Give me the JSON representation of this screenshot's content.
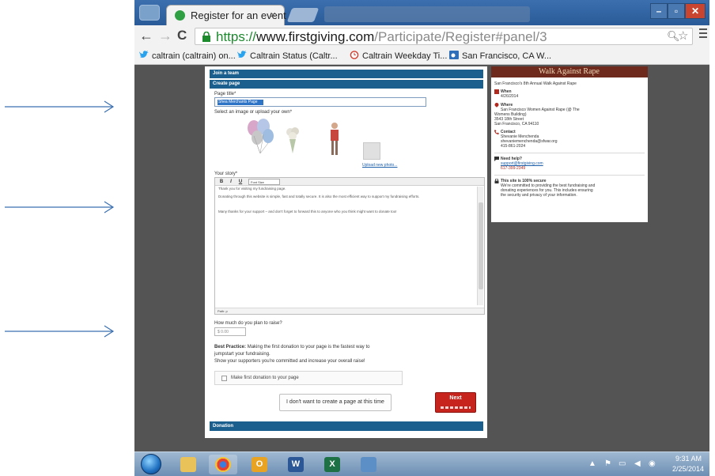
{
  "browser": {
    "tab_title": "Register for an event",
    "tab_close": "×",
    "url_scheme": "https://",
    "url_host": "www.firstgiving.com",
    "url_path": "/Participate/Register#panel/3",
    "bookmarks": [
      {
        "label": "caltrain (caltrain) on...",
        "icon": "twitter-bird-icon"
      },
      {
        "label": "Caltrain Status (Caltr...",
        "icon": "twitter-bird-icon"
      },
      {
        "label": "Caltrain Weekday Ti...",
        "icon": "clock-icon"
      },
      {
        "label": "San Francisco, CA W...",
        "icon": "weather-icon"
      }
    ],
    "accent_color": "#2a5b98"
  },
  "form": {
    "join_team_bar": "Join a team",
    "create_page_bar": "Create page",
    "page_title_label": "Page title*",
    "page_title_value": "Shea Merchants Page",
    "select_image_label": "Select an image or upload your own*",
    "upload_link": "Upload new photo...",
    "story_label": "Your story*",
    "editor_bold": "B",
    "editor_italic": "I",
    "editor_underline": "U",
    "editor_font_size": "Font Size",
    "story_line_1": "Thank you for visiting my fundraising page.",
    "story_line_2": "Donating through this website is simple, fast and totally secure. It is also the most efficient way to support my fundraising efforts.",
    "story_line_3": "Many thanks for your support – and don't forget to forward this to anyone who you think might want to donate too!",
    "editor_status": "Path: p",
    "goal_label": "How much do you plan to raise?",
    "goal_value": "$  0.00",
    "best_practice_title": "Best Practice:",
    "best_practice_text_1": " Making the first donation to your page is the fastest way to",
    "best_practice_text_2": "jumpstart your fundraising.",
    "best_practice_text_3": "Show your supporters you're committed and increase your overall raise!",
    "first_donation_checkbox": "Make first donation to your page",
    "skip_button": "I don't want to create a page at this time",
    "next_button": "Next",
    "donation_bar": "Donation",
    "brand_color": "#1b5f8e",
    "next_color": "#c6241c"
  },
  "event": {
    "banner": "Walk Against Rape",
    "name": "San Francisco's 8th Annual Walk Against Rape",
    "when_label": "When",
    "when_value": "4/26/2014",
    "where_label": "Where",
    "where_line_1": "San Francisco Women Against Rape (@ The",
    "where_line_2": "Womens Building)",
    "where_line_3": "3543 18th Street",
    "where_line_4": "San Francisco, CA 94110",
    "contact_label": "Contact",
    "contact_name": "Shevanie Menchenda",
    "contact_email": "shevaniemenchenda@sfwar.org",
    "contact_phone": "415-861-2024",
    "help_label": "Need help?",
    "help_email": "support@firstgiving.com",
    "help_phone": "617-399-2349",
    "secure_label": "This site is 100% secure",
    "secure_text_1": "We're committed to providing the best fundraising and",
    "secure_text_2": "donating experiences for you. This includes ensuring",
    "secure_text_3": "the security and privacy of your information."
  },
  "taskbar": {
    "apps": [
      {
        "name": "explorer",
        "glyph": ""
      },
      {
        "name": "chrome",
        "glyph": ""
      },
      {
        "name": "outlook",
        "glyph": "O"
      },
      {
        "name": "word",
        "glyph": "W"
      },
      {
        "name": "excel",
        "glyph": "X"
      },
      {
        "name": "unknown-app",
        "glyph": ""
      }
    ],
    "time": "9:31 AM",
    "date": "2/25/2014"
  }
}
